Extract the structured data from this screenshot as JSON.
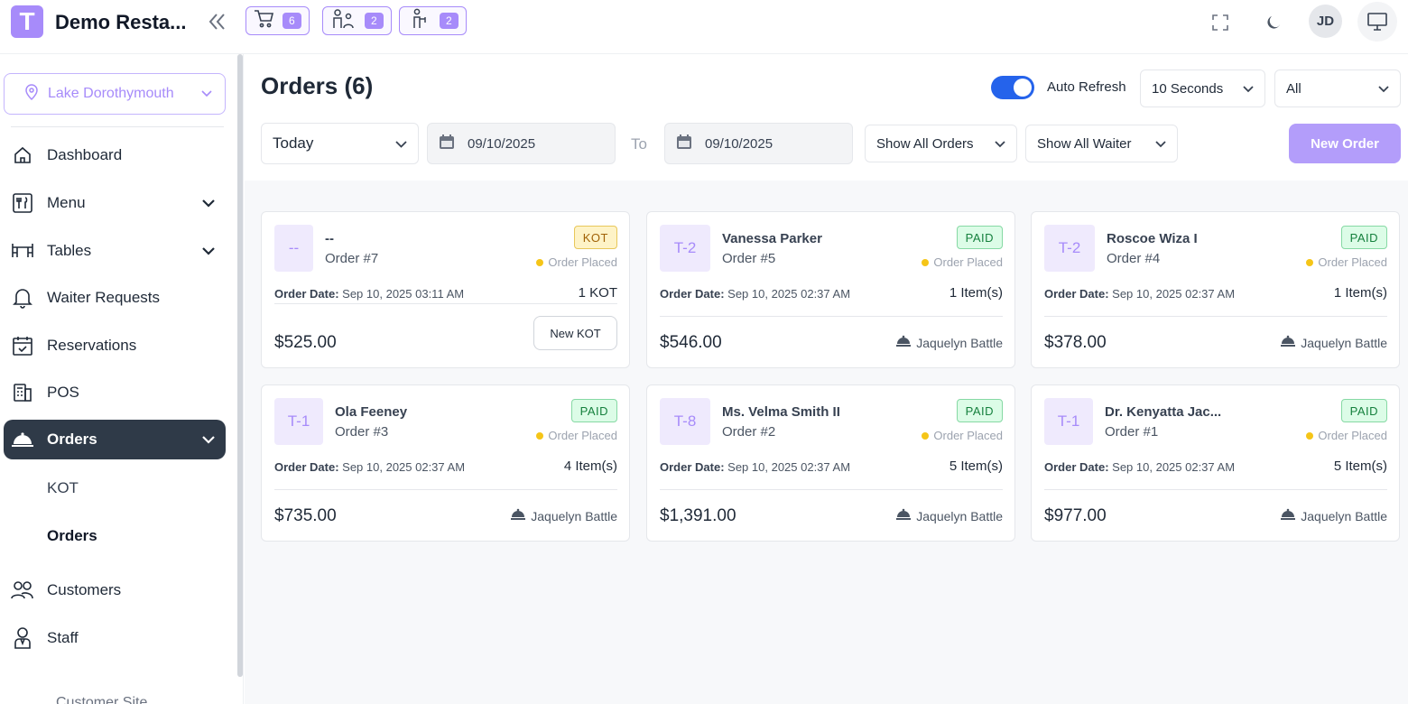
{
  "header": {
    "logo_letter": "T",
    "brand": "Demo Resta...",
    "badges": [
      {
        "icon": "cart-icon",
        "count": "6"
      },
      {
        "icon": "waiter-request-icon",
        "count": "2"
      },
      {
        "icon": "staff-call-icon",
        "count": "2"
      }
    ],
    "avatar_initials": "JD"
  },
  "sidebar": {
    "location": "Lake Dorothymouth",
    "items": [
      {
        "label": "Dashboard",
        "icon": "home-icon"
      },
      {
        "label": "Menu",
        "icon": "menu-icon"
      },
      {
        "label": "Tables",
        "icon": "table-icon"
      },
      {
        "label": "Waiter Requests",
        "icon": "bell-icon"
      },
      {
        "label": "Reservations",
        "icon": "calendar-check-icon"
      },
      {
        "label": "POS",
        "icon": "pos-icon"
      },
      {
        "label": "Orders",
        "icon": "cloche-icon"
      },
      {
        "label": "Customers",
        "icon": "users-icon"
      },
      {
        "label": "Staff",
        "icon": "staff-icon"
      }
    ],
    "orders_sub": [
      "KOT",
      "Orders"
    ],
    "cut_off_link": "Customer Site"
  },
  "main": {
    "title": "Orders (6)",
    "auto_refresh_label": "Auto Refresh",
    "auto_refresh_on": true,
    "refresh_interval": "10 Seconds",
    "filter_all": "All",
    "date_range": "Today",
    "date_from": "09/10/2025",
    "to_label": "To",
    "date_to": "09/10/2025",
    "orders_filter": "Show All Orders",
    "waiter_filter": "Show All Waiter",
    "new_order": "New Order",
    "order_date_label": "Order Date:",
    "accent_color": "#a78bfa",
    "toggle_color": "#2563eb"
  },
  "orders": [
    {
      "table": "--",
      "customer": "--",
      "order_no": "Order #7",
      "status": "KOT",
      "state": "Order Placed",
      "date": "Sep 10, 2025 03:11 AM",
      "count": "1 KOT",
      "amount": "$525.00",
      "action": "New KOT"
    },
    {
      "table": "T-2",
      "customer": "Vanessa Parker",
      "order_no": "Order #5",
      "status": "PAID",
      "state": "Order Placed",
      "date": "Sep 10, 2025 02:37 AM",
      "count": "1 Item(s)",
      "amount": "$546.00",
      "waiter": "Jaquelyn Battle"
    },
    {
      "table": "T-2",
      "customer": "Roscoe Wiza I",
      "order_no": "Order #4",
      "status": "PAID",
      "state": "Order Placed",
      "date": "Sep 10, 2025 02:37 AM",
      "count": "1 Item(s)",
      "amount": "$378.00",
      "waiter": "Jaquelyn Battle"
    },
    {
      "table": "T-1",
      "customer": "Ola Feeney",
      "order_no": "Order #3",
      "status": "PAID",
      "state": "Order Placed",
      "date": "Sep 10, 2025 02:37 AM",
      "count": "4 Item(s)",
      "amount": "$735.00",
      "waiter": "Jaquelyn Battle"
    },
    {
      "table": "T-8",
      "customer": "Ms. Velma Smith II",
      "order_no": "Order #2",
      "status": "PAID",
      "state": "Order Placed",
      "date": "Sep 10, 2025 02:37 AM",
      "count": "5 Item(s)",
      "amount": "$1,391.00",
      "waiter": "Jaquelyn Battle"
    },
    {
      "table": "T-1",
      "customer": "Dr. Kenyatta Jac...",
      "order_no": "Order #1",
      "status": "PAID",
      "state": "Order Placed",
      "date": "Sep 10, 2025 02:37 AM",
      "count": "5 Item(s)",
      "amount": "$977.00",
      "waiter": "Jaquelyn Battle"
    }
  ]
}
